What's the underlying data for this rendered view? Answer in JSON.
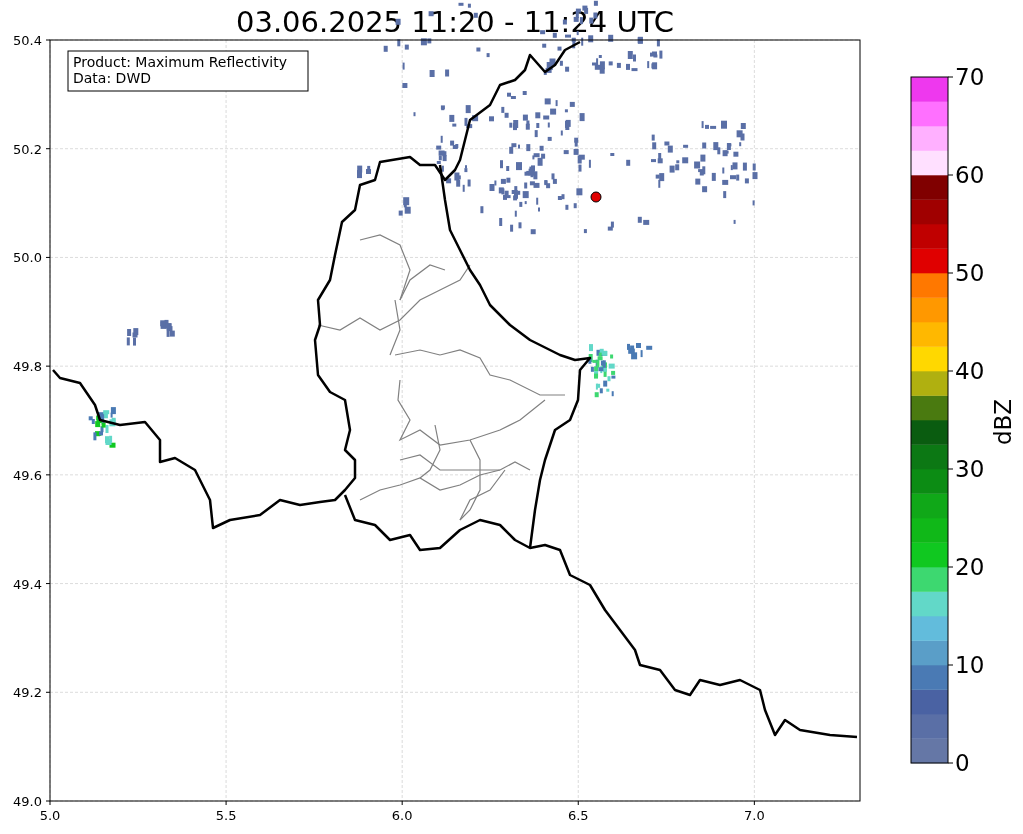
{
  "title": "03.06.2025 11:20 - 11:24 UTC",
  "info_box": [
    "Product: Maximum Reflectivity",
    "Data: DWD"
  ],
  "x_axis": {
    "ticks": [
      "5.0",
      "5.5",
      "6.0",
      "6.5",
      "7.0"
    ]
  },
  "y_axis": {
    "ticks": [
      "50.4",
      "50.2",
      "50.0",
      "49.8",
      "49.6",
      "49.4",
      "49.2",
      "49.0"
    ]
  },
  "colorbar": {
    "label": "dBZ",
    "ticks": [
      "70",
      "60",
      "50",
      "40",
      "30",
      "20",
      "10",
      "0"
    ],
    "segments": [
      {
        "color": "#6577a6"
      },
      {
        "color": "#5a6fa6"
      },
      {
        "color": "#4a62a3"
      },
      {
        "color": "#4a7ab4"
      },
      {
        "color": "#5a9ec8"
      },
      {
        "color": "#62bcdc"
      },
      {
        "color": "#62d8c8"
      },
      {
        "color": "#3dd870"
      },
      {
        "color": "#10c820"
      },
      {
        "color": "#10b818"
      },
      {
        "color": "#10a818"
      },
      {
        "color": "#0c8c14"
      },
      {
        "color": "#0c7814"
      },
      {
        "color": "#0a5c10"
      },
      {
        "color": "#4a7a10"
      },
      {
        "color": "#b0b010"
      },
      {
        "color": "#ffd800"
      },
      {
        "color": "#ffb800"
      },
      {
        "color": "#ff9800"
      },
      {
        "color": "#ff7800"
      },
      {
        "color": "#e00000"
      },
      {
        "color": "#c00000"
      },
      {
        "color": "#a00000"
      },
      {
        "color": "#800000"
      },
      {
        "color": "#ffe0ff"
      },
      {
        "color": "#ffb0ff"
      },
      {
        "color": "#ff70ff"
      },
      {
        "color": "#ee38ee"
      }
    ]
  }
}
